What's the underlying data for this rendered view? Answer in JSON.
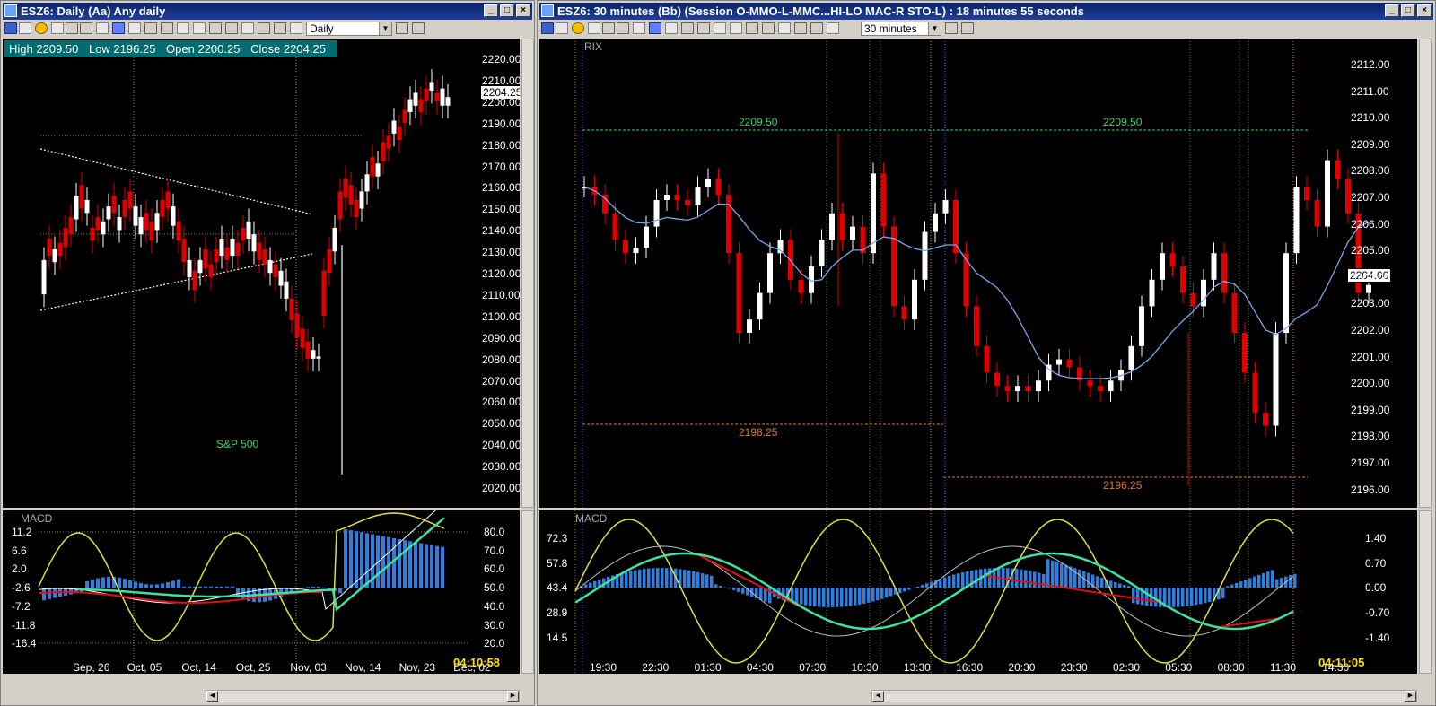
{
  "left": {
    "title": "ESZ6: Daily (Aa) Any daily",
    "timeframe": "Daily",
    "info": {
      "high": "High  2209.50",
      "low": "Low  2196.25",
      "open": "Open  2200.25",
      "close": "Close  2204.25"
    },
    "price_tag": "2204.25",
    "annotation": "S&P 500",
    "indicator": "MACD",
    "clock": "04:10:58",
    "price_axis": [
      "2220.00",
      "2210.00",
      "2200.00",
      "2190.00",
      "2180.00",
      "2170.00",
      "2160.00",
      "2150.00",
      "2140.00",
      "2130.00",
      "2120.00",
      "2110.00",
      "2100.00",
      "2090.00",
      "2080.00",
      "2070.00",
      "2060.00",
      "2050.00",
      "2040.00",
      "2030.00",
      "2020.00"
    ],
    "macd_left_axis": [
      "11.2",
      "6.6",
      "2.0",
      "-2.6",
      "-7.2",
      "-11.8",
      "-16.4"
    ],
    "macd_right_axis": [
      "80.0",
      "70.0",
      "60.0",
      "50.0",
      "40.0",
      "30.0",
      "20.0"
    ],
    "date_axis": [
      "Sep, 26",
      "Oct, 05",
      "Oct, 14",
      "Oct, 25",
      "Nov, 03",
      "Nov, 14",
      "Nov, 23",
      "Dec, 02"
    ]
  },
  "right": {
    "title": "ESZ6: 30 minutes (Bb) (Session O-MMO-L-MMC...HI-LO MAC-R STO-L) : 18 minutes 55 seconds",
    "timeframe": "30 minutes",
    "rix": "RIX",
    "price_tag": "2204.00",
    "level_high_a": "2209.50",
    "level_high_b": "2209.50",
    "level_low_a": "2198.25",
    "level_low_b": "2196.25",
    "indicator": "MACD",
    "clock": "04:11:05",
    "price_axis": [
      "2212.00",
      "2211.00",
      "2210.00",
      "2209.00",
      "2208.00",
      "2207.00",
      "2206.00",
      "2205.00",
      "2204.00",
      "2203.00",
      "2202.00",
      "2201.00",
      "2200.00",
      "2199.00",
      "2198.00",
      "2197.00",
      "2196.00"
    ],
    "macd_left_axis": [
      "72.3",
      "57.8",
      "43.4",
      "28.9",
      "14.5"
    ],
    "macd_right_axis": [
      "1.40",
      "0.70",
      "0.00",
      "-0.70",
      "-1.40"
    ],
    "time_axis": [
      "19:30",
      "22:30",
      "01:30",
      "04:30",
      "07:30",
      "10:30",
      "13:30",
      "16:30",
      "20:30",
      "23:30",
      "02:30",
      "05:30",
      "08:30",
      "11:30",
      "14:30"
    ]
  },
  "colors": {
    "bull": "#ffffff",
    "bear": "#e00000",
    "histogram": "#2f7fe0",
    "signal": "#40e0a0",
    "stoch": "#e0e040",
    "ma": "#7aa7e8",
    "level_high": "#40d070",
    "level_low": "#e07a20"
  }
}
